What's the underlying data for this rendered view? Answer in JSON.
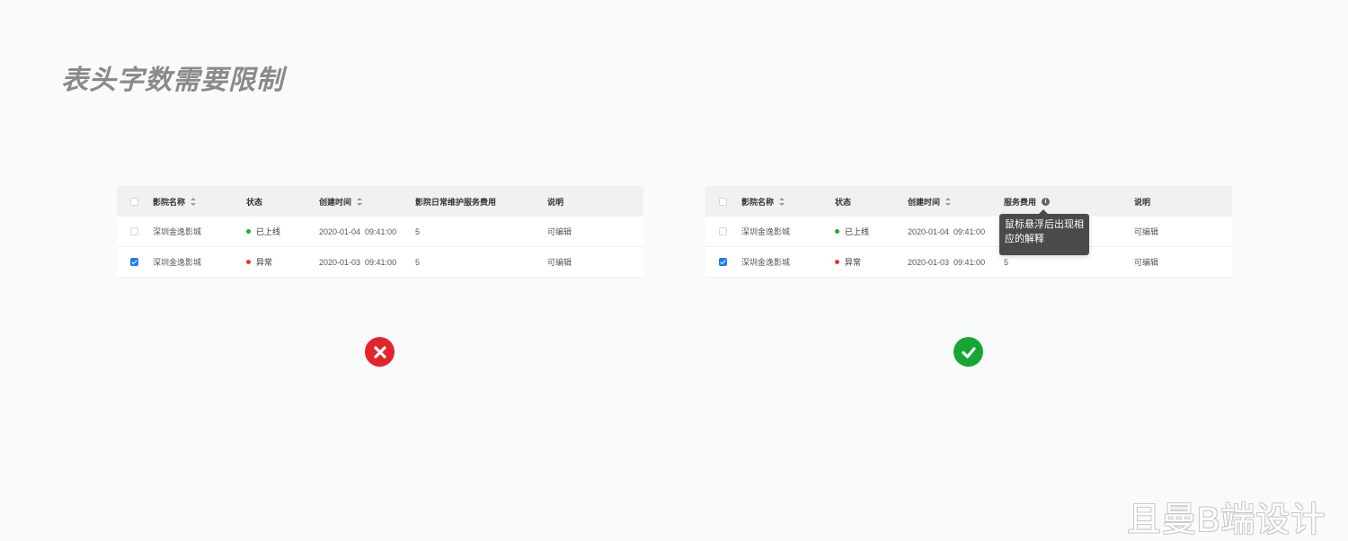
{
  "title": "表头字数需要限制",
  "bad_table": {
    "headers": {
      "name": "影院名称",
      "status": "状态",
      "time": "创建时间",
      "fee": "影院日常维护服务费用",
      "desc": "说明"
    },
    "rows": [
      {
        "name": "深圳金逸影城",
        "status": "已上线",
        "status_color": "#19b030",
        "time": "2020-01-04  09:41:00",
        "fee": "5",
        "desc": "可编辑",
        "checked": false
      },
      {
        "name": "深圳金逸影城",
        "status": "异常",
        "status_color": "#e4362b",
        "time": "2020-01-03  09:41:00",
        "fee": "5",
        "desc": "可编辑",
        "checked": true
      }
    ]
  },
  "good_table": {
    "headers": {
      "name": "影院名称",
      "status": "状态",
      "time": "创建时间",
      "fee": "服务费用",
      "desc": "说明"
    },
    "rows": [
      {
        "name": "深圳金逸影城",
        "status": "已上线",
        "status_color": "#19b030",
        "time": "2020-01-04  09:41:00",
        "fee": "",
        "desc": "可编辑",
        "checked": false
      },
      {
        "name": "深圳金逸影城",
        "status": "异常",
        "status_color": "#e4362b",
        "time": "2020-01-03  09:41:00",
        "fee": "5",
        "desc": "可编辑",
        "checked": true
      }
    ],
    "tooltip": {
      "line1": "鼠标悬浮后出现相",
      "line2": "应的解释"
    },
    "info_icon_label": "i"
  },
  "result_icons": {
    "bad": "close-circle-icon",
    "good": "check-circle-icon",
    "bad_color": "#e4242b",
    "good_color": "#16a631"
  },
  "watermark": "且曼B端设计"
}
